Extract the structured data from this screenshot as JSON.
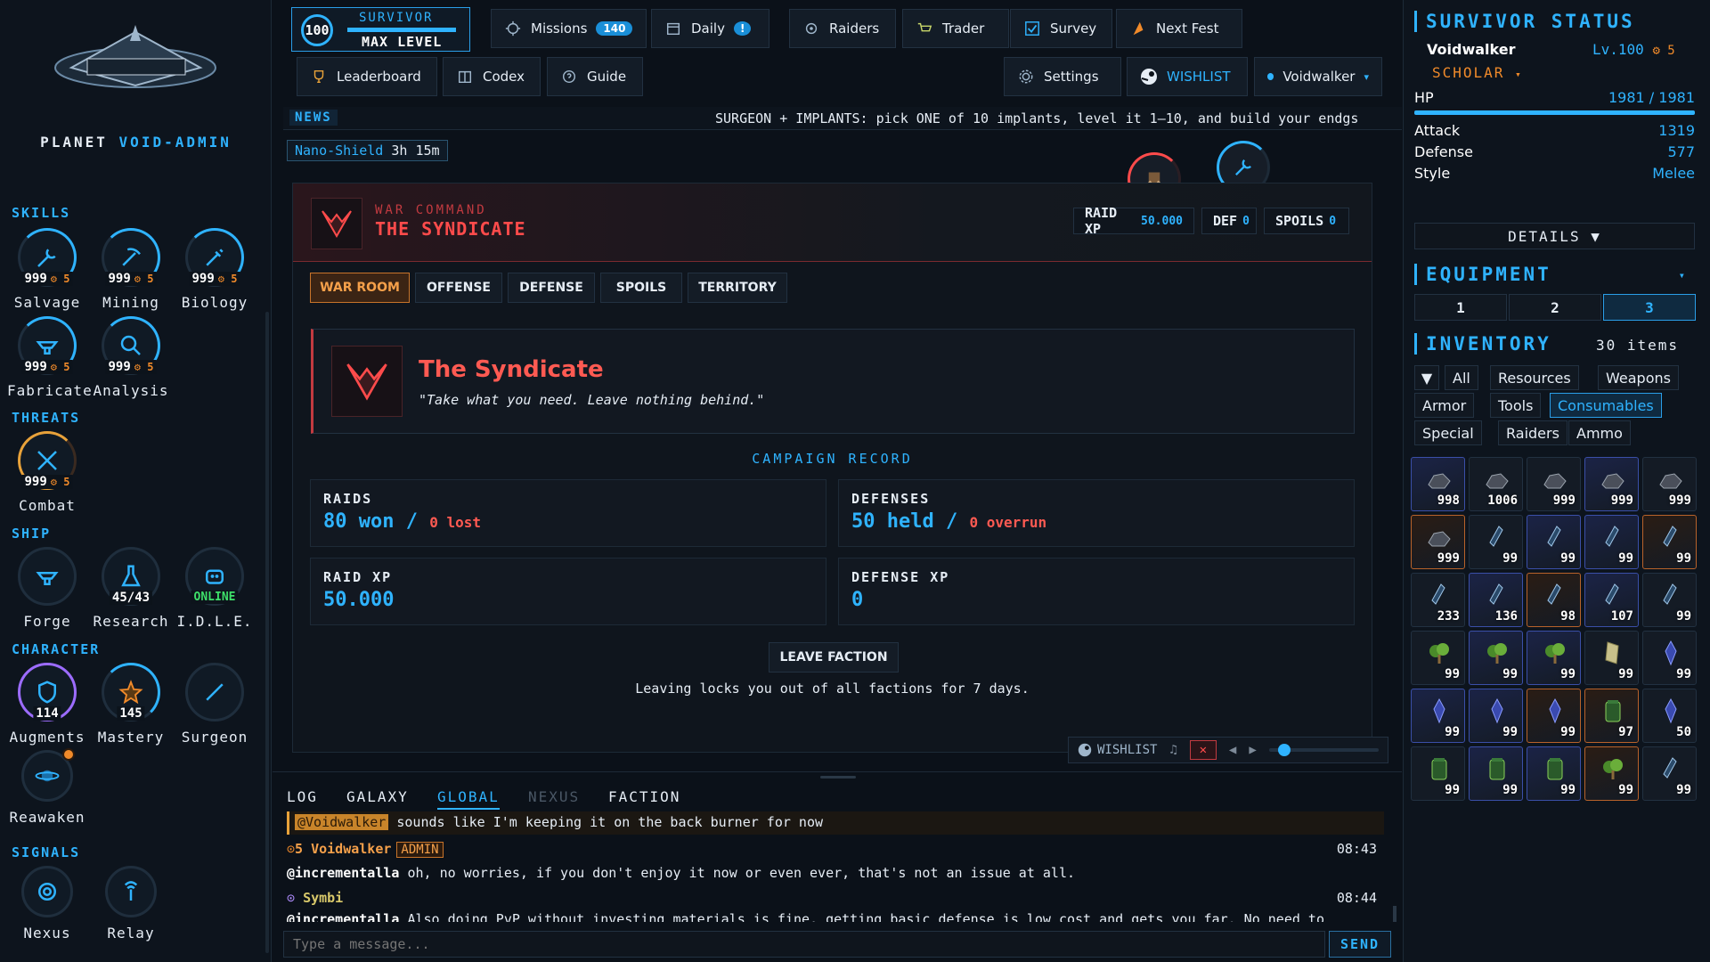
{
  "left": {
    "planet_label": "PLANET",
    "planet_name": "VOID-ADMIN",
    "sections": {
      "skills": "SKILLS",
      "threats": "THREATS",
      "ship": "SHIP",
      "character": "CHARACTER",
      "signals": "SIGNALS"
    },
    "skills": [
      {
        "name": "Salvage",
        "level": "999",
        "prestige": "5"
      },
      {
        "name": "Mining",
        "level": "999",
        "prestige": "5"
      },
      {
        "name": "Biology",
        "level": "999",
        "prestige": "5"
      },
      {
        "name": "Fabricate",
        "level": "999",
        "prestige": "5"
      },
      {
        "name": "Analysis",
        "level": "999",
        "prestige": "5"
      }
    ],
    "threats": [
      {
        "name": "Combat",
        "level": "999",
        "prestige": "5"
      }
    ],
    "ship": [
      {
        "name": "Forge",
        "value": ""
      },
      {
        "name": "Research",
        "value": "45/43"
      },
      {
        "name": "I.D.L.E.",
        "value": "ONLINE"
      }
    ],
    "character": [
      {
        "name": "Augments",
        "value": "114"
      },
      {
        "name": "Mastery",
        "value": "145"
      },
      {
        "name": "Surgeon",
        "value": ""
      },
      {
        "name": "Reawaken",
        "value": ""
      }
    ],
    "signals": [
      {
        "name": "Nexus"
      },
      {
        "name": "Relay"
      }
    ]
  },
  "topbar": {
    "survivor_level": "100",
    "survivor_label": "SURVIVOR",
    "survivor_status": "MAX LEVEL",
    "missions": "Missions",
    "missions_count": "140",
    "daily": "Daily",
    "daily_badge": "!",
    "raiders": "Raiders",
    "trader": "Trader",
    "survey": "Survey",
    "next_fest": "Next Fest",
    "leaderboard": "Leaderboard",
    "codex": "Codex",
    "guide": "Guide",
    "settings": "Settings",
    "wishlist": "WISHLIST",
    "account": "Voidwalker"
  },
  "news": {
    "label": "NEWS",
    "text": "SURGEON + IMPLANTS: pick ONE of 10 implants, level it 1–10, and build your endgs"
  },
  "buff": {
    "name": "Nano-Shield",
    "time": "3h 15m"
  },
  "panel": {
    "subtitle": "WAR COMMAND",
    "title": "THE SYNDICATE",
    "raid_xp_label": "RAID XP",
    "raid_xp_value": "50.000",
    "def_label": "DEF",
    "def_value": "0",
    "spoils_label": "SPOILS",
    "spoils_value": "0",
    "tabs": [
      "WAR ROOM",
      "OFFENSE",
      "DEFENSE",
      "SPOILS",
      "TERRITORY"
    ],
    "faction_name": "The Syndicate",
    "faction_quote": "\"Take what you need. Leave nothing behind.\"",
    "campaign_title": "CAMPAIGN RECORD",
    "raids_label": "RAIDS",
    "raids_won": "80 won",
    "raids_lost": "0 lost",
    "defenses_label": "DEFENSES",
    "defenses_held": "50 held",
    "defenses_overrun": "0 overrun",
    "raid_xp_box_label": "RAID XP",
    "raid_xp_box_value": "50.000",
    "defense_xp_label": "DEFENSE XP",
    "defense_xp_value": "0",
    "leave_button": "LEAVE FACTION",
    "leave_note": "Leaving locks you out of all factions for 7 days."
  },
  "media": {
    "wishlist": "WISHLIST",
    "volume": 0.08
  },
  "chat": {
    "tabs": [
      "LOG",
      "GALAXY",
      "GLOBAL",
      "NEXUS",
      "FACTION"
    ],
    "quote_mention": "@Voidwalker",
    "quote_text": " sounds like I'm keeping it on the back burner for now",
    "messages": [
      {
        "prefix": "5",
        "user": "Voidwalker",
        "role": "ADMIN",
        "time": "08:43",
        "mention": "@incrementalla",
        "text": " oh, no worries, if you don't enjoy it now or even ever, that's not an issue at all."
      },
      {
        "user": "Symbi",
        "time": "08:44",
        "mention": "@incrementalla",
        "text": " Also doing PvP without investing materials is fine, getting basic defense is low cost and gets you far. No need to"
      }
    ],
    "placeholder": "Type a message...",
    "send": "SEND"
  },
  "right": {
    "status_title": "SURVIVOR STATUS",
    "name": "Voidwalker",
    "level": "Lv.100",
    "prestige": "5",
    "class": "SCHOLAR",
    "hp_label": "HP",
    "hp_value": "1981 / 1981",
    "attack_label": "Attack",
    "attack_value": "1319",
    "defense_label": "Defense",
    "defense_value": "577",
    "style_label": "Style",
    "style_value": "Melee",
    "details": "DETAILS ▼",
    "equipment_title": "EQUIPMENT",
    "loadouts": [
      "1",
      "2",
      "3"
    ],
    "inventory_title": "INVENTORY",
    "inventory_count": "30 items",
    "filters": [
      "All",
      "Resources",
      "Weapons",
      "Armor",
      "Tools",
      "Consumables",
      "Special",
      "Raiders",
      "Ammo"
    ],
    "items": [
      {
        "q": "998",
        "rar": "blue",
        "icon": "ore-icon"
      },
      {
        "q": "1006",
        "rar": "",
        "icon": "ore-icon"
      },
      {
        "q": "999",
        "rar": "",
        "icon": "ore-icon"
      },
      {
        "q": "999",
        "rar": "blue",
        "icon": "ore-icon"
      },
      {
        "q": "999",
        "rar": "",
        "icon": "ore-icon"
      },
      {
        "q": "999",
        "rar": "orange",
        "icon": "ore-icon"
      },
      {
        "q": "99",
        "rar": "",
        "icon": "vial-icon"
      },
      {
        "q": "99",
        "rar": "blue",
        "icon": "vial-icon"
      },
      {
        "q": "99",
        "rar": "blue",
        "icon": "vial-icon"
      },
      {
        "q": "99",
        "rar": "orange",
        "icon": "vial-icon"
      },
      {
        "q": "233",
        "rar": "",
        "icon": "vial-icon"
      },
      {
        "q": "136",
        "rar": "blue",
        "icon": "vial-icon"
      },
      {
        "q": "98",
        "rar": "orange",
        "icon": "vial-icon"
      },
      {
        "q": "107",
        "rar": "blue",
        "icon": "vial-icon"
      },
      {
        "q": "99",
        "rar": "",
        "icon": "vial-icon"
      },
      {
        "q": "99",
        "rar": "",
        "icon": "herb-icon"
      },
      {
        "q": "99",
        "rar": "blue",
        "icon": "herb-icon"
      },
      {
        "q": "99",
        "rar": "blue",
        "icon": "herb-icon"
      },
      {
        "q": "99",
        "rar": "",
        "icon": "scroll-icon"
      },
      {
        "q": "99",
        "rar": "",
        "icon": "crystal-icon"
      },
      {
        "q": "99",
        "rar": "blue",
        "icon": "crystal-icon"
      },
      {
        "q": "99",
        "rar": "blue",
        "icon": "crystal-icon"
      },
      {
        "q": "99",
        "rar": "orange",
        "icon": "crystal-icon"
      },
      {
        "q": "97",
        "rar": "orange",
        "icon": "canister-icon"
      },
      {
        "q": "50",
        "rar": "",
        "icon": "crystal-icon"
      },
      {
        "q": "99",
        "rar": "",
        "icon": "canister-icon"
      },
      {
        "q": "99",
        "rar": "blue",
        "icon": "canister-icon"
      },
      {
        "q": "99",
        "rar": "blue",
        "icon": "canister-icon"
      },
      {
        "q": "99",
        "rar": "orange",
        "icon": "herb-icon"
      },
      {
        "q": "99",
        "rar": "",
        "icon": "vial-icon"
      }
    ]
  },
  "colors": {
    "accent": "#2fb3ff",
    "danger": "#ff4b4b",
    "warning": "#f08a2a",
    "online": "#3ee06a"
  }
}
